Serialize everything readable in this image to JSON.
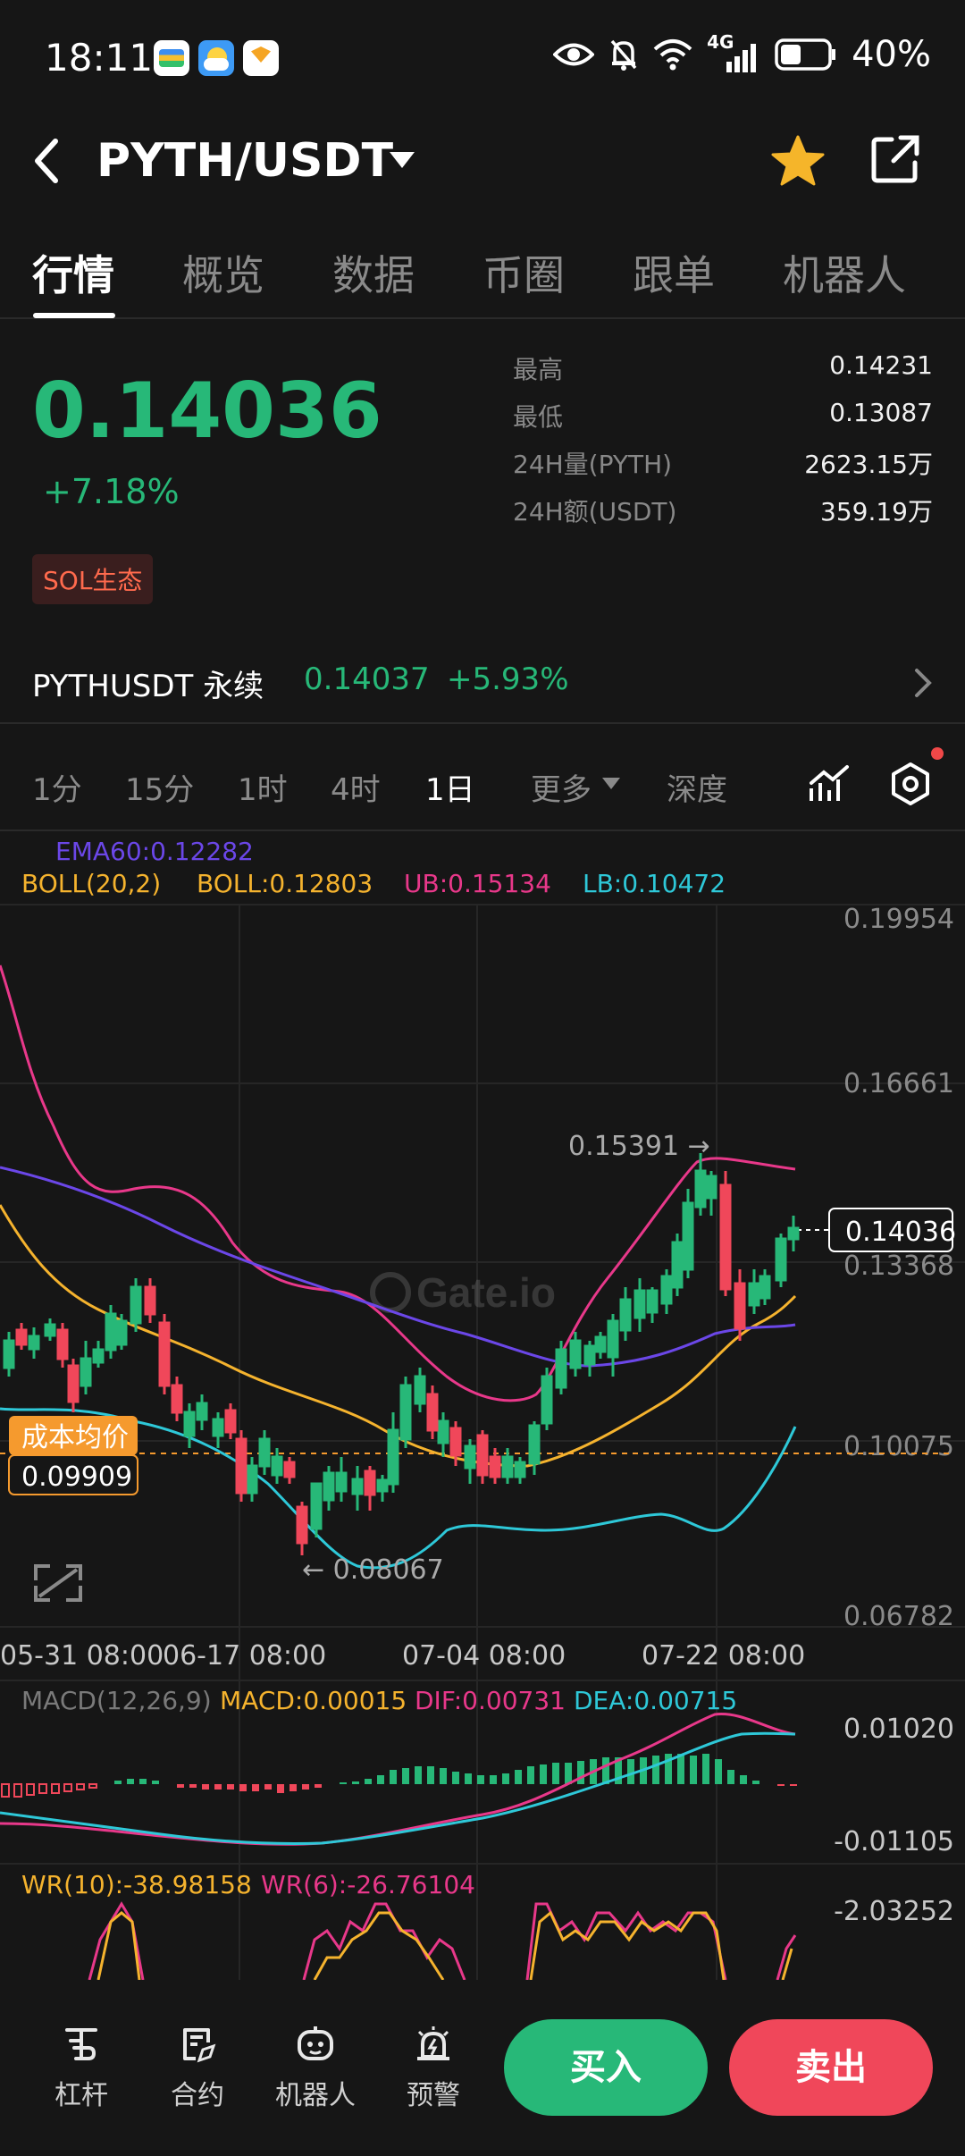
{
  "status": {
    "time": "18:11",
    "network": "4G",
    "battery": "40%"
  },
  "header": {
    "pair": "PYTH/USDT"
  },
  "tabs": [
    {
      "label": "行情"
    },
    {
      "label": "概览"
    },
    {
      "label": "数据"
    },
    {
      "label": "币圈"
    },
    {
      "label": "跟单"
    },
    {
      "label": "机器人"
    }
  ],
  "ticker": {
    "price": "0.14036",
    "change": "+7.18%",
    "tag": "SOL生态"
  },
  "stats": [
    {
      "label": "最高",
      "value": "0.14231"
    },
    {
      "label": "最低",
      "value": "0.13087"
    },
    {
      "label": "24H量(PYTH)",
      "value": "2623.15万"
    },
    {
      "label": "24H额(USDT)",
      "value": "359.19万"
    }
  ],
  "perpetual": {
    "name": "PYTHUSDT 永续",
    "price": "0.14037",
    "change": "+5.93%"
  },
  "intervals": [
    {
      "label": "1分"
    },
    {
      "label": "15分"
    },
    {
      "label": "1时"
    },
    {
      "label": "4时"
    },
    {
      "label": "1日"
    },
    {
      "label": "更多"
    },
    {
      "label": "深度"
    }
  ],
  "indicators": {
    "ema": "EMA60:0.12282",
    "boll_params": "BOLL(20,2)",
    "boll": "BOLL:0.12803",
    "ub": "UB:0.15134",
    "lb": "LB:0.10472",
    "macd_params": "MACD(12,26,9)",
    "macd": "MACD:0.00015",
    "dif": "DIF:0.00731",
    "dea": "DEA:0.00715",
    "wr10": "WR(10):-38.98158",
    "wr6": "WR(6):-26.76104"
  },
  "chart_data": {
    "type": "candlestick",
    "y_ticks": [
      "0.19954",
      "0.16661",
      "0.13368",
      "0.10075",
      "0.06782"
    ],
    "x_ticks": [
      "05-31 08:00",
      "06-17 08:00",
      "07-04 08:00",
      "07-22 08:00"
    ],
    "current_price": "0.14036",
    "cost_label": "成本均价",
    "cost_price": "0.09909",
    "high_mark": "0.15391 →",
    "low_mark": "← 0.08067",
    "watermark": "Gate.io",
    "macd_ticks": [
      "0.01020",
      "-0.01105"
    ],
    "wr_tick": "-2.03252",
    "colors": {
      "up": "#27b878",
      "down": "#f0475a",
      "ema": "#6b47e8",
      "boll": "#f5b32e",
      "ub": "#e8388a",
      "lb": "#2ec8d8"
    }
  },
  "bottom_nav": {
    "items": [
      {
        "label": "杠杆"
      },
      {
        "label": "合约"
      },
      {
        "label": "机器人"
      },
      {
        "label": "预警"
      }
    ],
    "buy": "买入",
    "sell": "卖出"
  }
}
